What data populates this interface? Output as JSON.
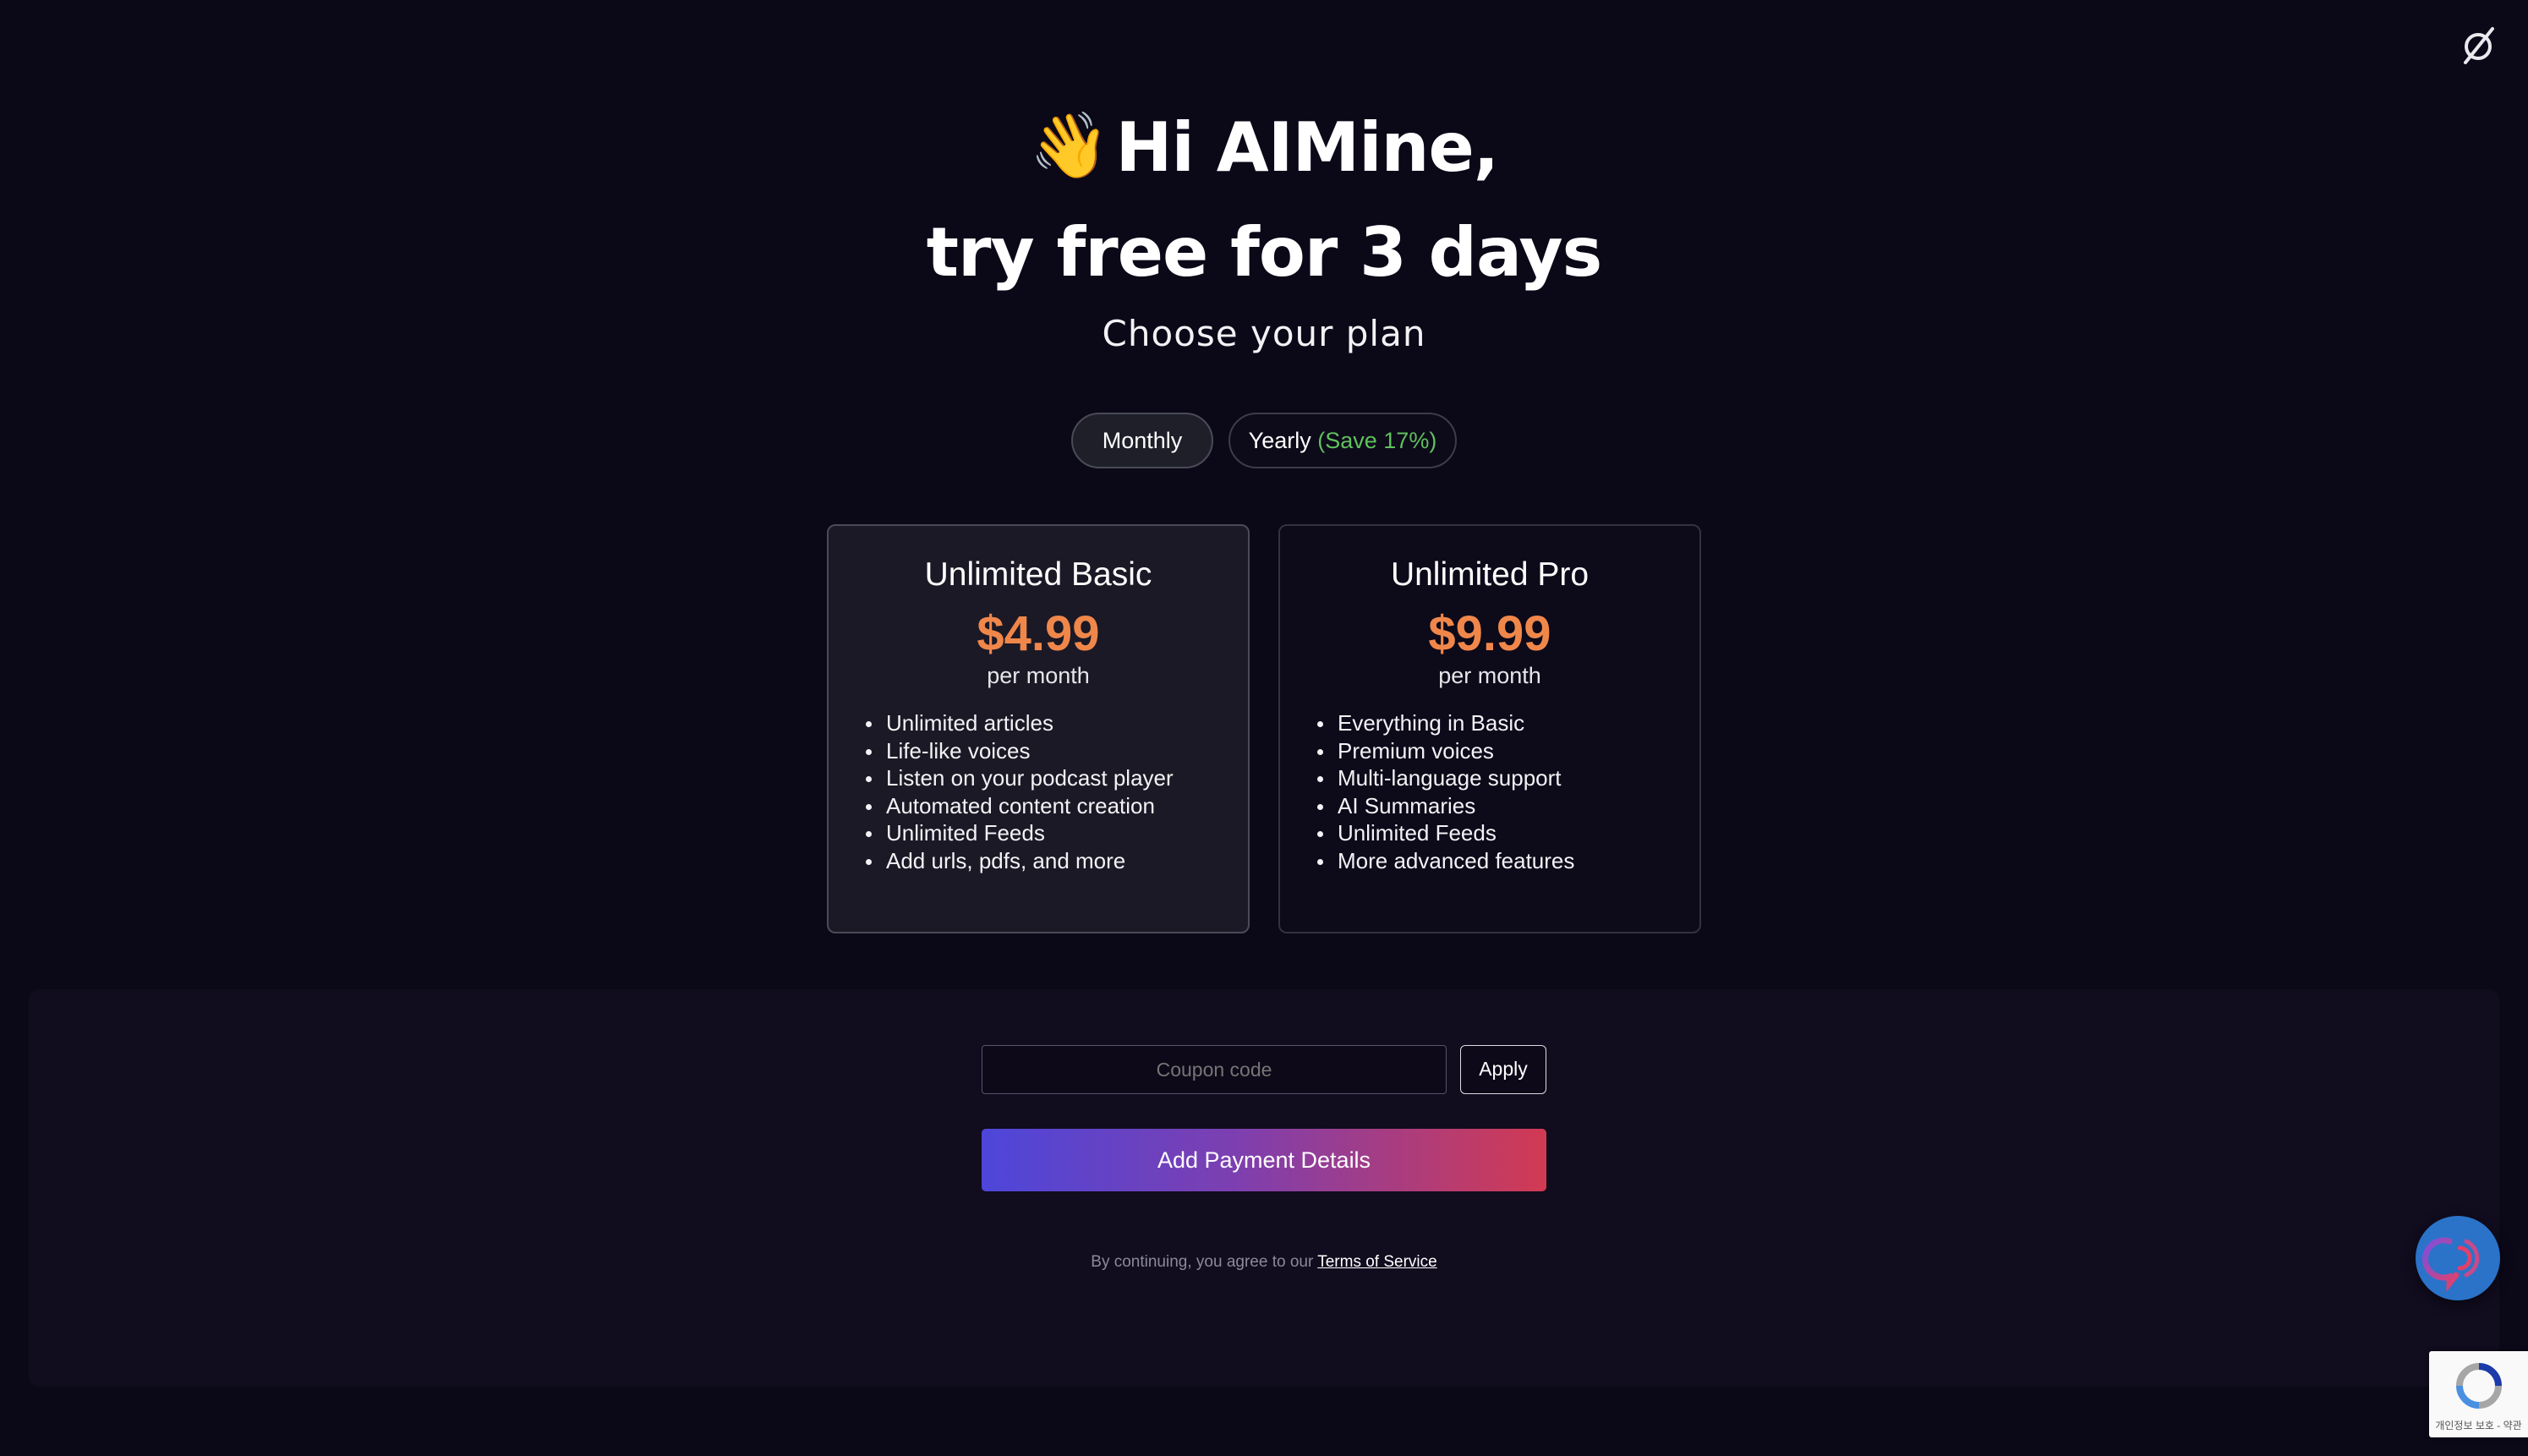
{
  "header": {
    "greeting": "Hi AIMine,",
    "wave_icon": "waving-hand-icon",
    "headline": "try free for 3 days",
    "subtitle": "Choose your plan",
    "logo_icon": "empty-set-logo-icon"
  },
  "billing": {
    "monthly_label": "Monthly",
    "yearly_label": "Yearly",
    "yearly_savings": "(Save 17%)",
    "selected": "monthly",
    "savings_color": "#5fc15c"
  },
  "plans": [
    {
      "name": "Unlimited Basic",
      "price": "$4.99",
      "period": "per month",
      "selected": true,
      "features": [
        "Unlimited articles",
        "Life-like voices",
        "Listen on your podcast player",
        "Automated content creation",
        "Unlimited Feeds",
        "Add urls, pdfs, and more"
      ]
    },
    {
      "name": "Unlimited Pro",
      "price": "$9.99",
      "period": "per month",
      "selected": false,
      "features": [
        "Everything in Basic",
        "Premium voices",
        "Multi-language support",
        "AI Summaries",
        "Unlimited Feeds",
        "More advanced features"
      ]
    }
  ],
  "checkout": {
    "coupon_placeholder": "Coupon code",
    "coupon_value": "",
    "apply_label": "Apply",
    "pay_label": "Add Payment Details",
    "terms_prefix": "By continuing, you agree to our",
    "terms_link": "Terms of Service"
  },
  "widgets": {
    "chat_icon": "audio-chat-icon",
    "recaptcha_icon": "recaptcha-icon",
    "recaptcha_text": "개인정보 보호 - 약관"
  },
  "colors": {
    "background": "#0b0818",
    "price": "#f0874a",
    "gradient_start": "#4d46da",
    "gradient_end": "#d23a52",
    "fab": "#2a73c9"
  }
}
